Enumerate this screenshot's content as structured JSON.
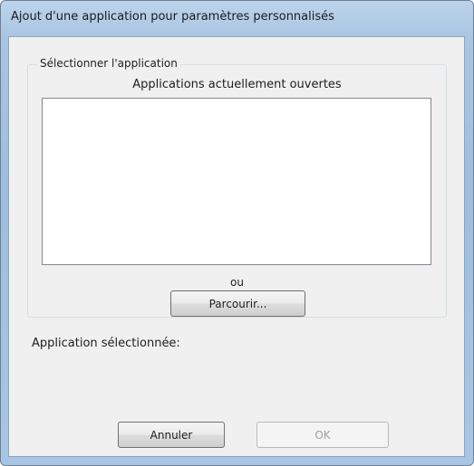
{
  "window": {
    "title": "Ajout d'une application pour paramètres personnalisés"
  },
  "group": {
    "label": "Sélectionner l'application",
    "list_caption": "Applications actuellement ouvertes",
    "list_items": [],
    "or_text": "ou",
    "browse_label": "Parcourir..."
  },
  "selected": {
    "label": "Application sélectionnée:",
    "value": ""
  },
  "buttons": {
    "cancel_label": "Annuler",
    "ok_label": "OK",
    "ok_enabled": false
  },
  "colors": {
    "frame": "#a9c5e2",
    "client": "#f0f0f0",
    "disabled_text": "#a0a0a0"
  }
}
